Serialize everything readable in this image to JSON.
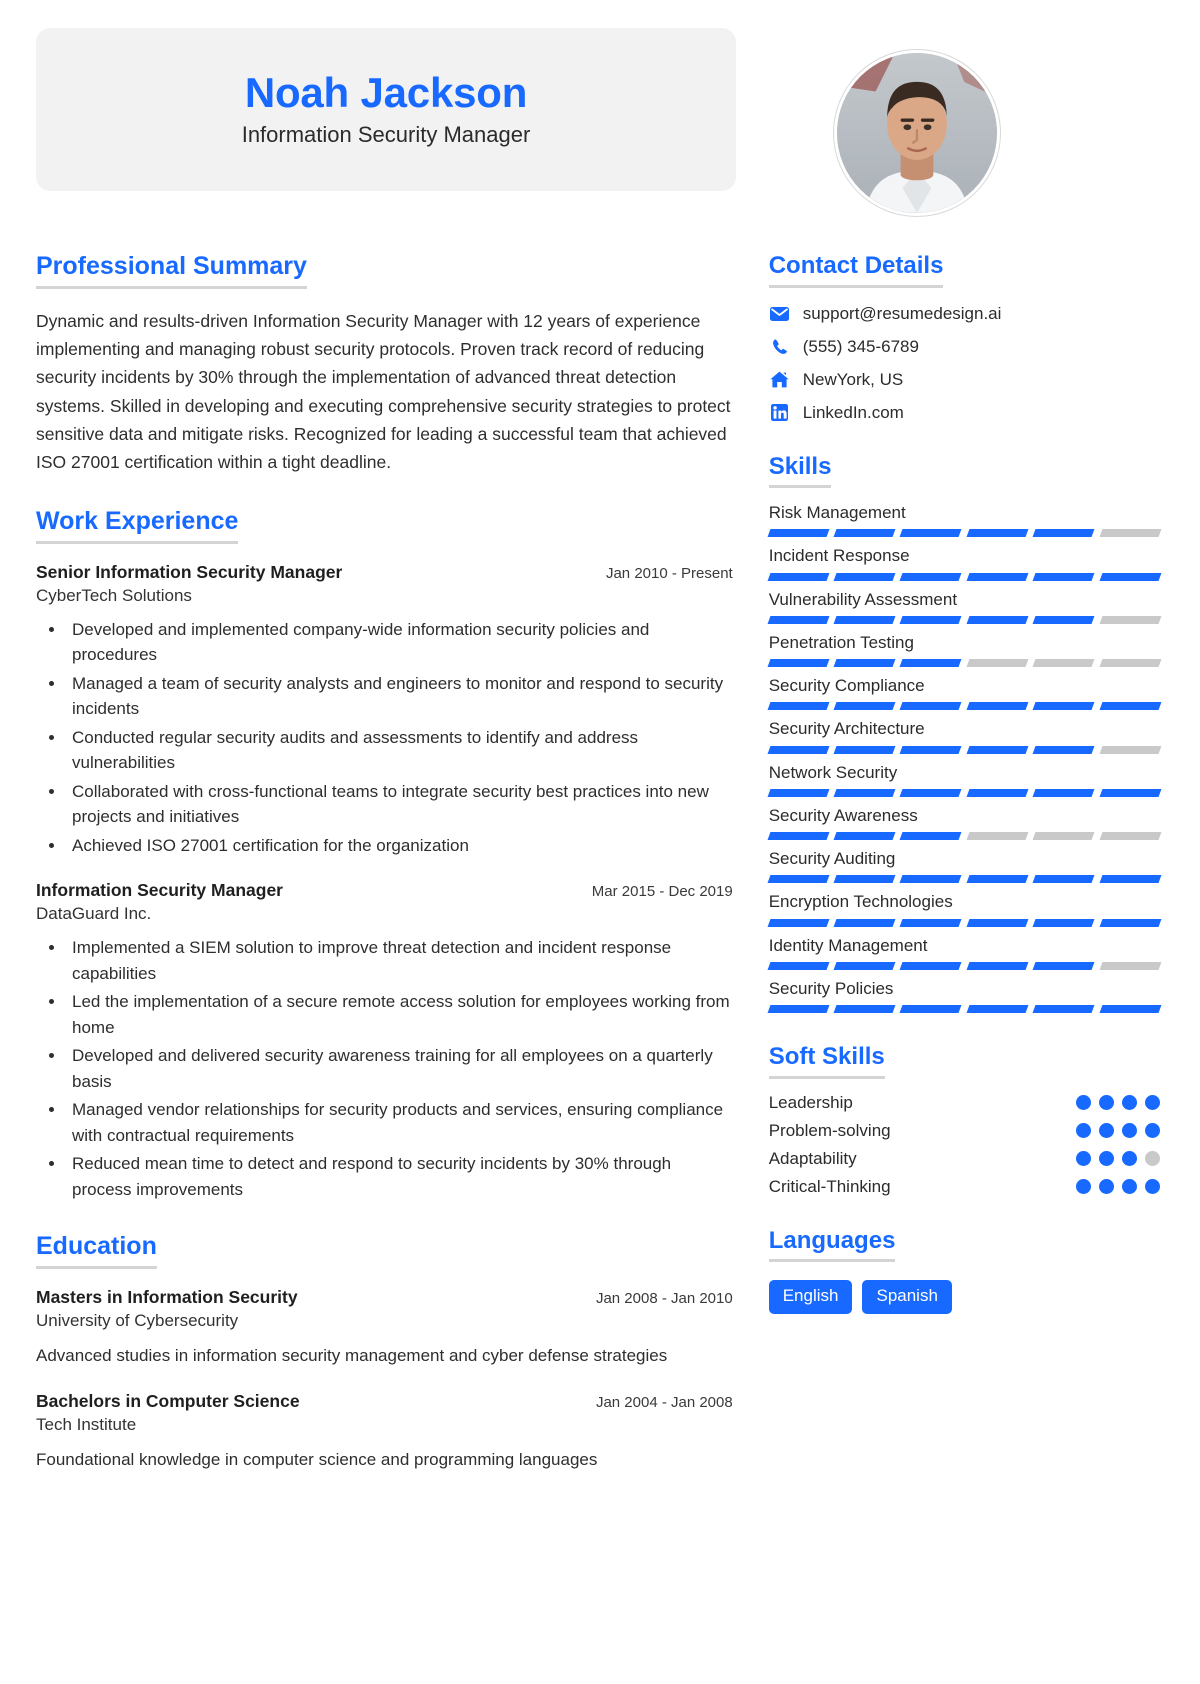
{
  "header": {
    "name": "Noah Jackson",
    "title": "Information Security Manager",
    "avatar_alt": "profile-photo"
  },
  "summary": {
    "heading": "Professional Summary",
    "text": "Dynamic and results-driven Information Security Manager with 12 years of experience implementing and managing robust security protocols. Proven track record of reducing security incidents by 30% through the implementation of advanced threat detection systems. Skilled in developing and executing comprehensive security strategies to protect sensitive data and mitigate risks. Recognized for leading a successful team that achieved ISO 27001 certification within a tight deadline."
  },
  "experience": {
    "heading": "Work Experience",
    "items": [
      {
        "role": "Senior Information Security Manager",
        "date": "Jan 2010 - Present",
        "org": "CyberTech Solutions",
        "bullets": [
          "Developed and implemented company-wide information security policies and procedures",
          "Managed a team of security analysts and engineers to monitor and respond to security incidents",
          "Conducted regular security audits and assessments to identify and address vulnerabilities",
          "Collaborated with cross-functional teams to integrate security best practices into new projects and initiatives",
          "Achieved ISO 27001 certification for the organization"
        ]
      },
      {
        "role": "Information Security Manager",
        "date": "Mar 2015 - Dec 2019",
        "org": "DataGuard Inc.",
        "bullets": [
          "Implemented a SIEM solution to improve threat detection and incident response capabilities",
          "Led the implementation of a secure remote access solution for employees working from home",
          "Developed and delivered security awareness training for all employees on a quarterly basis",
          "Managed vendor relationships for security products and services, ensuring compliance with contractual requirements",
          "Reduced mean time to detect and respond to security incidents by 30% through process improvements"
        ]
      }
    ]
  },
  "education": {
    "heading": "Education",
    "items": [
      {
        "degree": "Masters in Information Security",
        "date": "Jan 2008 - Jan 2010",
        "school": "University of Cybersecurity",
        "desc": "Advanced studies in information security management and cyber defense strategies"
      },
      {
        "degree": "Bachelors in Computer Science",
        "date": "Jan 2004 - Jan 2008",
        "school": "Tech Institute",
        "desc": "Foundational knowledge in computer science and programming languages"
      }
    ]
  },
  "contact": {
    "heading": "Contact Details",
    "items": [
      {
        "icon": "envelope-icon",
        "value": "support@resumedesign.ai"
      },
      {
        "icon": "phone-icon",
        "value": "(555) 345-6789"
      },
      {
        "icon": "home-icon",
        "value": "NewYork, US"
      },
      {
        "icon": "linkedin-icon",
        "value": "LinkedIn.com"
      }
    ]
  },
  "skills": {
    "heading": "Skills",
    "segments_total": 6,
    "items": [
      {
        "name": "Risk Management",
        "filled": 5
      },
      {
        "name": "Incident Response",
        "filled": 6
      },
      {
        "name": "Vulnerability Assessment",
        "filled": 5
      },
      {
        "name": "Penetration Testing",
        "filled": 3
      },
      {
        "name": "Security Compliance",
        "filled": 6
      },
      {
        "name": "Security Architecture",
        "filled": 5
      },
      {
        "name": "Network Security",
        "filled": 6
      },
      {
        "name": "Security Awareness",
        "filled": 3
      },
      {
        "name": "Security Auditing",
        "filled": 6
      },
      {
        "name": "Encryption Technologies",
        "filled": 6
      },
      {
        "name": "Identity Management",
        "filled": 5
      },
      {
        "name": "Security Policies",
        "filled": 6
      }
    ]
  },
  "soft_skills": {
    "heading": "Soft Skills",
    "dots_total": 4,
    "items": [
      {
        "name": "Leadership",
        "filled": 4
      },
      {
        "name": "Problem-solving",
        "filled": 4
      },
      {
        "name": "Adaptability",
        "filled": 3
      },
      {
        "name": "Critical-Thinking",
        "filled": 4
      }
    ]
  },
  "languages": {
    "heading": "Languages",
    "items": [
      "English",
      "Spanish"
    ]
  },
  "colors": {
    "accent": "#1769ff",
    "banner_bg": "#f2f2f2",
    "rule": "#d4d4d4",
    "muted_bar": "#c9c9c9",
    "text": "#2b2b2b"
  }
}
